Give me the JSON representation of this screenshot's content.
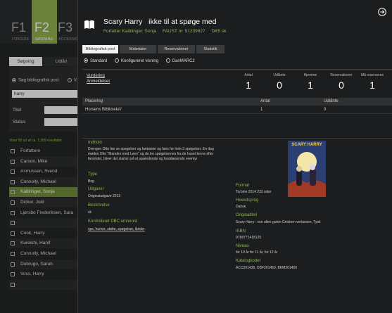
{
  "background": {
    "fkeys": [
      {
        "key": "F1",
        "label": "FORSIDE"
      },
      {
        "key": "F2",
        "label": "SØGNING"
      },
      {
        "key": "F3",
        "label": "ACCESSION"
      }
    ],
    "tabs": [
      "Søgning",
      "Udlån"
    ],
    "radio": [
      "Søg bibliografisk post",
      "V"
    ],
    "search_value": "harry",
    "labels": {
      "title": "Titel",
      "status": "Status"
    },
    "result_text": "Viser 50 ud af ca. 1.309 resultater",
    "rows": [
      "Forfattere",
      "Carson, Mike",
      "Asmussen, Svend",
      "Connolly, Michael",
      "Kaiblinger, Sonja",
      "Dicker, Joël",
      "Ljørsbo Frederiksen, Sara",
      "",
      "Cook, Harry",
      "Kureishi, Hanif",
      "Connolly, Michael",
      "Dubrugo, Sarah",
      "Voss, Harry",
      ""
    ]
  },
  "modal": {
    "title": "Scary Harry   ikke til at spøge med",
    "meta": {
      "author": "Forfatter Kaiblinger, Sonja",
      "faust": "FAUST nr. 51239827",
      "dk5": "DK5 sk"
    },
    "tabs": [
      "Bibliografisk post",
      "Materialer",
      "Reservationer",
      "Statistik"
    ],
    "view_options": [
      "Standard",
      "Konfigureret visning",
      "DanMARC2"
    ],
    "ratings": [
      "Vurdering",
      "Anmeldelser"
    ],
    "stats": [
      {
        "label": "Antal",
        "value": "1"
      },
      {
        "label": "Udlånte",
        "value": "0"
      },
      {
        "label": "Hjemme",
        "value": "1"
      },
      {
        "label": "Reservationer",
        "value": "0"
      },
      {
        "label": "Mã reserveres",
        "value": "1"
      }
    ],
    "location_headers": [
      "Placering",
      "Antal",
      "Udlånte"
    ],
    "location_rows": [
      [
        "Horsens Bibliotek///",
        "1",
        "0"
      ]
    ],
    "sections": [
      {
        "h": "Indhold",
        "t": "Drengen Otto fan se spøgelser og fantasien og fans for hele 3 spøgelser. En dag mødes Otto \"Manden med Leen\" og de tre spøgelsernes fra de huset kerne efter farvinder, bliver det starten på et spændende og hesblæsende eventyr"
      },
      {
        "h": "Type",
        "t": "Bog"
      },
      {
        "h": "Udgaver",
        "t": "Originaludgave 2013"
      },
      {
        "h": "Beskrivelse",
        "t": "sk"
      },
      {
        "h": "Kontrolleret DBC emneord",
        "t": "sps, humor, stølte, spøgelser, lånder"
      }
    ],
    "right_sections": [
      {
        "h": "Format",
        "t": "Torbine 2014 233 sider"
      },
      {
        "h": "Hovedsprog",
        "t": "Dansk"
      },
      {
        "h": "Originaltitel",
        "t": "Scary Harry : von allen guten Geistern verlassen, Tysk"
      },
      {
        "h": "ISBN",
        "t": "9788771418125"
      },
      {
        "h": "Niveau",
        "t": "for 10 år for 11 år, for 12 år"
      },
      {
        "h": "Katalogkoder",
        "t": "ACC201435, DBF201450, BKM201450"
      }
    ],
    "cover_title": "SCARY HARRY",
    "accent": "#8eb548"
  }
}
